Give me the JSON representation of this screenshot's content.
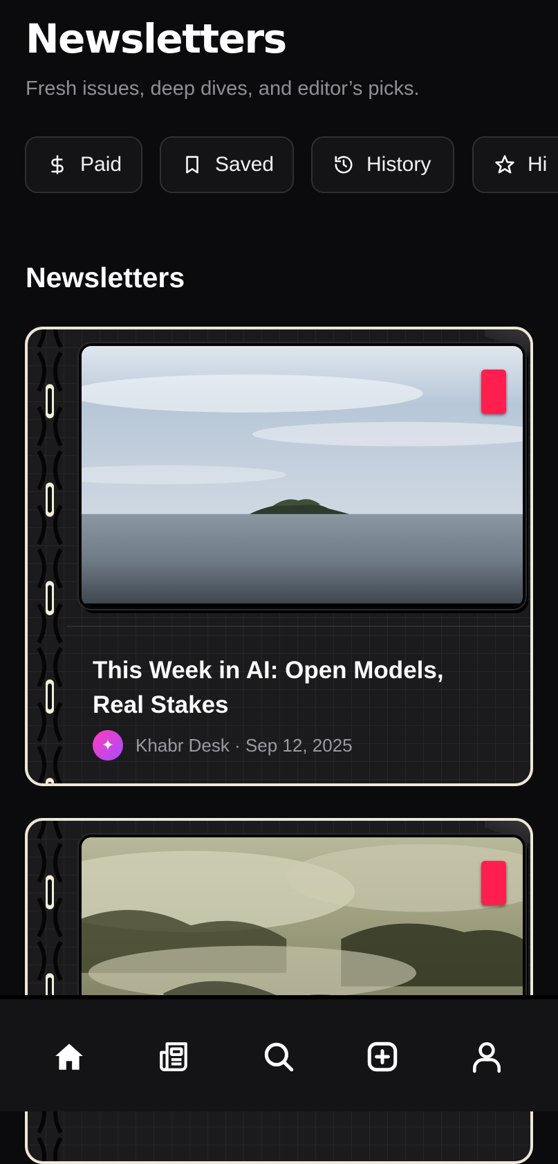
{
  "header": {
    "title": "Newsletters",
    "subtitle": "Fresh issues, deep dives, and editor’s picks."
  },
  "chips": [
    {
      "label": "Paid",
      "icon": "dollar-icon"
    },
    {
      "label": "Saved",
      "icon": "bookmark-icon"
    },
    {
      "label": "History",
      "icon": "history-icon"
    },
    {
      "label": "Hi",
      "icon": "star-icon"
    }
  ],
  "section": {
    "title": "Newsletters"
  },
  "cards": [
    {
      "title": "This Week in AI: Open Models, Real Stakes",
      "avatar_glyph": "✦",
      "meta": "Khabr Desk · Sep 12, 2025",
      "image": "island-seascape"
    },
    {
      "image": "misty-forest"
    }
  ],
  "nav": [
    {
      "icon": "home-icon",
      "active": true
    },
    {
      "icon": "newspaper-icon"
    },
    {
      "icon": "search-icon"
    },
    {
      "icon": "add-icon"
    },
    {
      "icon": "profile-icon"
    }
  ],
  "colors": {
    "background": "#0b0b0d",
    "accent_tag": "#ff1f4f",
    "card_border": "#efe7d6",
    "muted_text": "#8f8f97"
  }
}
